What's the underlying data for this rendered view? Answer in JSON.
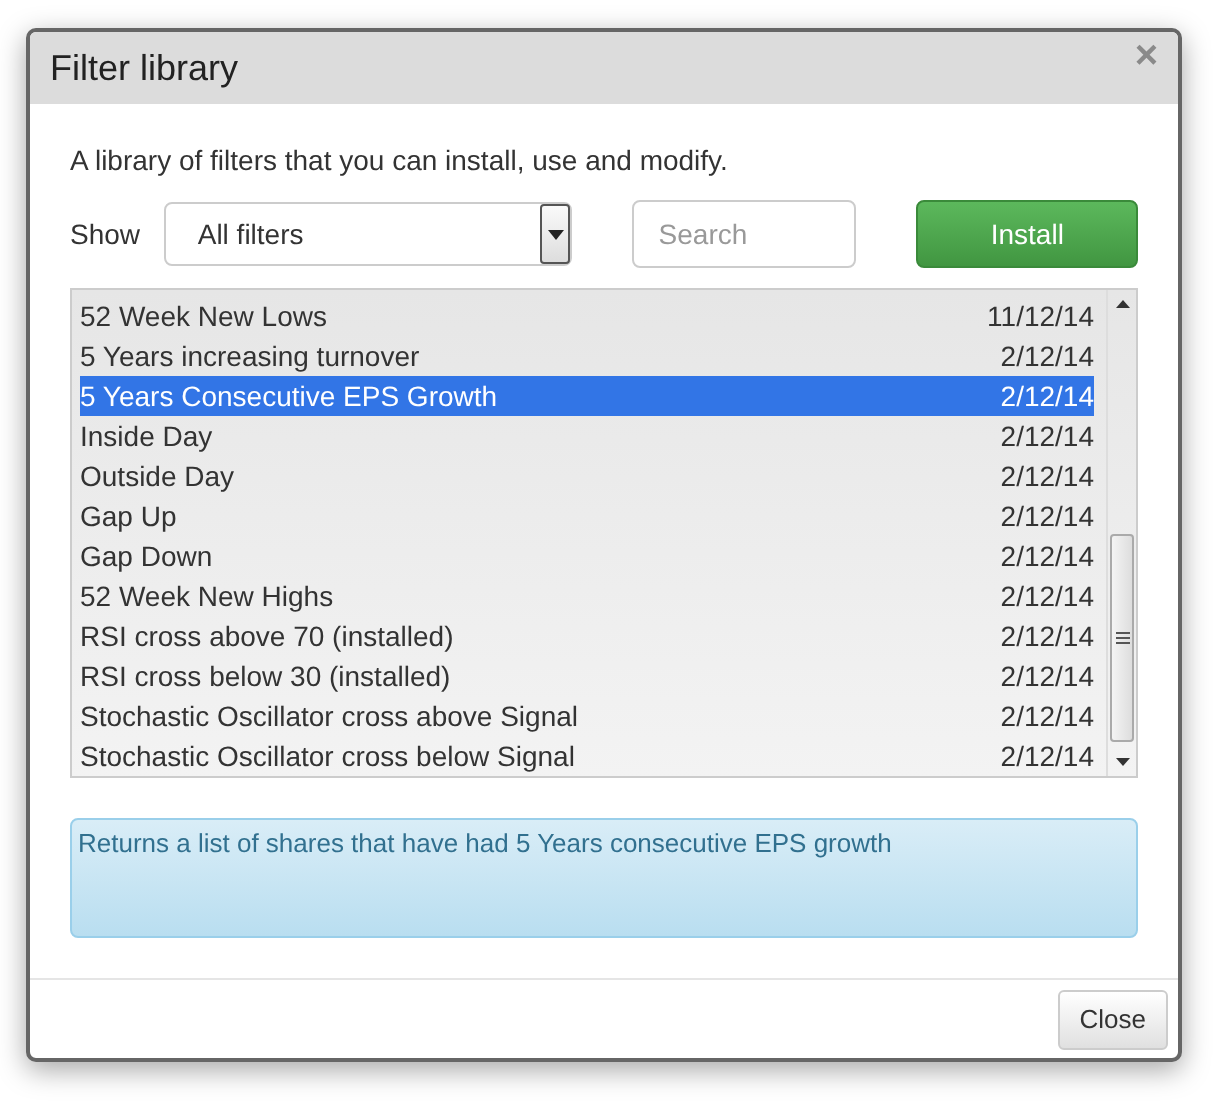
{
  "dialog": {
    "title": "Filter library",
    "close_glyph": "×"
  },
  "description": "A library of filters that you can install, use and modify.",
  "show": {
    "label": "Show",
    "value": "All filters"
  },
  "search": {
    "placeholder": "Search"
  },
  "install_button": "Install",
  "filters": [
    {
      "name": "52 Week New Lows",
      "date": "11/12/14",
      "selected": false
    },
    {
      "name": "5 Years increasing turnover",
      "date": "2/12/14",
      "selected": false
    },
    {
      "name": "5 Years Consecutive EPS Growth",
      "date": "2/12/14",
      "selected": true
    },
    {
      "name": "Inside Day",
      "date": "2/12/14",
      "selected": false
    },
    {
      "name": "Outside Day",
      "date": "2/12/14",
      "selected": false
    },
    {
      "name": "Gap Up",
      "date": "2/12/14",
      "selected": false
    },
    {
      "name": "Gap Down",
      "date": "2/12/14",
      "selected": false
    },
    {
      "name": "52 Week New Highs",
      "date": "2/12/14",
      "selected": false
    },
    {
      "name": "RSI cross above 70 (installed)",
      "date": "2/12/14",
      "selected": false
    },
    {
      "name": "RSI cross below 30 (installed)",
      "date": "2/12/14",
      "selected": false
    },
    {
      "name": "Stochastic Oscillator cross above Signal",
      "date": "2/12/14",
      "selected": false
    },
    {
      "name": "Stochastic Oscillator cross below Signal",
      "date": "2/12/14",
      "selected": false
    }
  ],
  "info": "Returns a list of shares that have had 5 Years consecutive EPS growth",
  "close_button": "Close"
}
